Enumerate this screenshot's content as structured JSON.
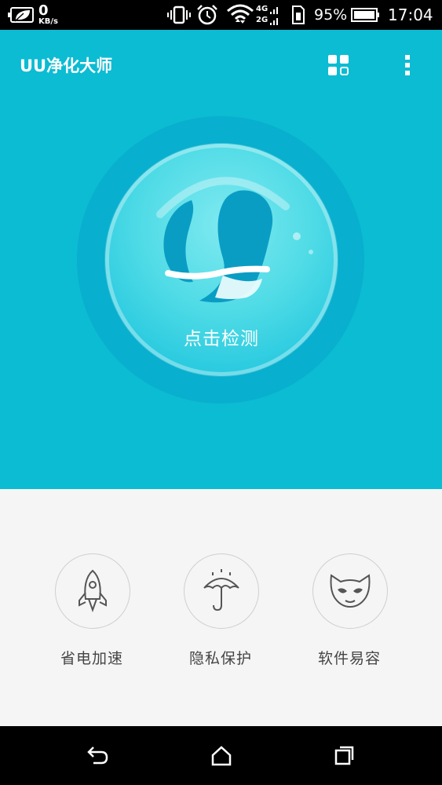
{
  "status_bar": {
    "net_speed_value": "0",
    "net_speed_unit": "KB/s",
    "net_4g": "4G",
    "net_2g": "2G",
    "battery_percent": "95%",
    "time": "17:04"
  },
  "app_bar": {
    "title": "UU净化大师",
    "grid_icon": "grid-apps-icon",
    "menu_icon": "more-vertical-icon"
  },
  "main": {
    "scan_label": "点击检测",
    "logo_icon": "uu-logo-icon",
    "hero_color": "#0bbcd3"
  },
  "features": [
    {
      "label": "省电加速",
      "icon": "rocket-icon"
    },
    {
      "label": "隐私保护",
      "icon": "umbrella-icon"
    },
    {
      "label": "软件易容",
      "icon": "mask-icon"
    }
  ],
  "nav_bar": {
    "back_icon": "back-icon",
    "home_icon": "home-icon",
    "recents_icon": "recents-icon"
  }
}
